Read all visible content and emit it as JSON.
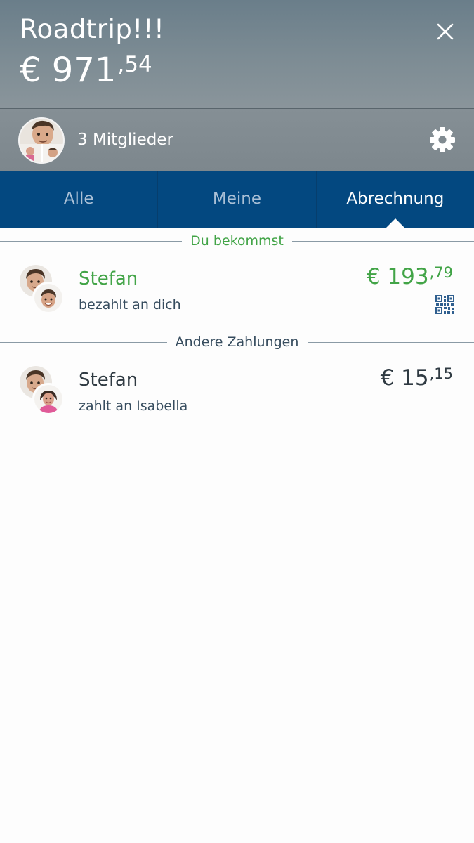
{
  "header": {
    "title": "Roadtrip!!!",
    "total_main": "€ 971",
    "total_decimals": ",54"
  },
  "members": {
    "label": "3 Mitglieder"
  },
  "tabs": [
    {
      "label": "Alle",
      "active": false
    },
    {
      "label": "Meine",
      "active": false
    },
    {
      "label": "Abrechnung",
      "active": true
    }
  ],
  "sections": {
    "receive": {
      "title": "Du bekommst",
      "color": "#42a447",
      "payment": {
        "name": "Stefan",
        "description": "bezahlt an dich",
        "amount_main": "€ 193",
        "amount_decimals": ",79"
      }
    },
    "others": {
      "title": "Andere Zahlungen",
      "color": "#364c5e",
      "payment": {
        "name": "Stefan",
        "description": "zahlt an Isabella",
        "amount_main": "€ 15",
        "amount_decimals": ",15"
      }
    }
  },
  "icons": {
    "close": "close-icon",
    "settings": "gear-icon",
    "qr": "qr-code-icon"
  }
}
